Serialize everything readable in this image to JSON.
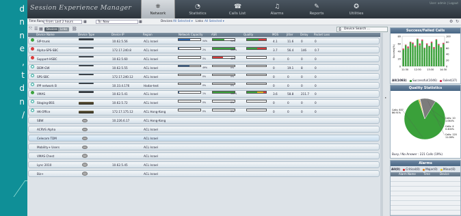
{
  "side_text": [
    "d",
    "n",
    "n",
    "e",
    ",",
    "t",
    "d",
    "n",
    "/"
  ],
  "app": {
    "logo": "Session Experience Manager",
    "user": "User: admin  |  Logout"
  },
  "nav": [
    {
      "label": "Network",
      "icon": "network-icon",
      "glyph": "⛯",
      "active": true
    },
    {
      "label": "Statistics",
      "icon": "statistics-icon",
      "glyph": "◔",
      "active": false
    },
    {
      "label": "Calls List",
      "icon": "calls-list-icon",
      "glyph": "☎",
      "active": false
    },
    {
      "label": "Alarms",
      "icon": "alarms-icon",
      "glyph": "♫",
      "active": false
    },
    {
      "label": "Reports",
      "icon": "reports-icon",
      "glyph": "✎",
      "active": false
    },
    {
      "label": "Utilities",
      "icon": "utilities-icon",
      "glyph": "✪",
      "active": false
    }
  ],
  "toolbar": {
    "time_range_label": "Time Range:",
    "time_range_value": "From: Last 2 hours",
    "to_value": "To: Now",
    "devices_label": "Devices",
    "devices_value": "All Selected ▾",
    "links_label": "Links",
    "links_value": "All Selected ▾",
    "view_devices": "Devices",
    "view_links": "Links",
    "device_search": "Device Search ..."
  },
  "columns": [
    "Device Name",
    "Device Type",
    "Device IP",
    "Region",
    "Network Capacity",
    "ASR",
    "Quality",
    "MOS",
    "Jitter",
    "Delay",
    "Packet Loss"
  ],
  "devices": [
    {
      "name": "SIP-trunk",
      "status": "green",
      "type": "rack",
      "ip": "10.62.5.56",
      "region": "ACL Israel",
      "cap": 54,
      "capc": "#2a69b5",
      "asr": 54,
      "asrc": "#3da33d",
      "quality": [
        [
          "#3da33d",
          0.6
        ],
        [
          "#d93b3b",
          0.4
        ]
      ],
      "mos": "4.1",
      "jitter": "11.6",
      "delay": "0",
      "loss": "0"
    },
    {
      "name": "Alpha-SPS-SBC",
      "status": "red",
      "type": "rack",
      "ip": "172.17.240.8",
      "region": "ACL Israel",
      "cap": 2,
      "capc": "#2a69b5",
      "asr": 100,
      "asrc": "#3da33d",
      "quality": [
        [
          "#3da33d",
          0.55
        ],
        [
          "#d93b3b",
          0.45
        ]
      ],
      "mos": "3.7",
      "jitter": "56.4",
      "delay": "146",
      "loss": "0.7"
    },
    {
      "name": "Support-HSBC",
      "status": "red",
      "type": "rack",
      "ip": "10.62.5.60",
      "region": "ACL Israel",
      "cap": 0,
      "capc": "#2a69b5",
      "asr": 46,
      "asrc": "#d93b3b",
      "quality": [],
      "mos": "0",
      "jitter": "0",
      "delay": "0",
      "loss": "0"
    },
    {
      "name": "DEM-GW",
      "status": "teal",
      "type": "rack",
      "ip": "10.62.5.55",
      "region": "ACL Israel",
      "cap": 49,
      "capc": "#2a69b5",
      "asr": 0,
      "asrc": "#3da33d",
      "quality": [],
      "mos": "0",
      "jitter": "19.1",
      "delay": "8",
      "loss": "0"
    },
    {
      "name": "SPS-SBC",
      "status": "teal",
      "type": "rack",
      "ip": "172.17.240.12",
      "region": "ACL Israel",
      "cap": 0,
      "capc": "#2a69b5",
      "asr": 0,
      "asrc": "#3da33d",
      "quality": [],
      "mos": "0",
      "jitter": "0",
      "delay": "0",
      "loss": "0"
    },
    {
      "name": "IPP network B",
      "status": "teal",
      "type": "rack",
      "ip": "10.33.4.176",
      "region": "Hadar-test",
      "cap": 0,
      "capc": "#2a69b5",
      "asr": 0,
      "asrc": "#3da33d",
      "quality": [],
      "mos": "0",
      "jitter": "0",
      "delay": "0",
      "loss": "0"
    },
    {
      "name": "VMAS",
      "status": "green",
      "type": "rack",
      "ip": "10.62.5.41",
      "region": "ACL Israel",
      "cap": 1,
      "capc": "#2a69b5",
      "asr": 100,
      "asrc": "#3da33d",
      "quality": [
        [
          "#3da33d",
          0.55
        ],
        [
          "#e8b820",
          0.3
        ],
        [
          "#d93b3b",
          0.15
        ]
      ],
      "mos": "3.6",
      "jitter": "58.8",
      "delay": "211.7",
      "loss": "0"
    },
    {
      "name": "Staging-BSS",
      "status": "teal",
      "type": "server",
      "ip": "10.62.5.72",
      "region": "ACL Israel",
      "cap": 0,
      "capc": "#2a69b5",
      "asr": 0,
      "asrc": "#3da33d",
      "quality": [],
      "mos": "0",
      "jitter": "0",
      "delay": "0",
      "loss": "0"
    },
    {
      "name": "HK-Office",
      "status": "teal",
      "type": "server",
      "ip": "172.17.175.12",
      "region": "ACL Hong-Kong",
      "cap": 0,
      "capc": "#2a69b5",
      "asr": 0,
      "asrc": "#3da33d",
      "quality": [],
      "mos": "0",
      "jitter": "0",
      "delay": "0",
      "loss": "0"
    },
    {
      "name": "SBW",
      "status": "none",
      "type": "packet",
      "ip": "10.226.6.17",
      "region": "ACL Hong-Kong",
      "cap": null
    },
    {
      "name": "ACRVS Alpha",
      "status": "none",
      "type": "packet",
      "ip": "",
      "region": "ACL Israel",
      "cap": null
    },
    {
      "name": "Celecom TDM",
      "status": "none",
      "type": "packet",
      "ip": "",
      "region": "ACL Israel",
      "cap": null,
      "sel": true
    },
    {
      "name": "Mobility+ Users",
      "status": "none",
      "type": "packet",
      "ip": "",
      "region": "ACL Israel",
      "cap": null
    },
    {
      "name": "VMAS Chest",
      "status": "none",
      "type": "packet",
      "ip": "",
      "region": "ACL Israel",
      "cap": null
    },
    {
      "name": "Lync 2010",
      "status": "none",
      "type": "packet",
      "ip": "10.62.5.45",
      "region": "ACL Israel",
      "cap": null
    },
    {
      "name": "Biz+",
      "status": "none",
      "type": "packet",
      "ip": "",
      "region": "ACL Israel",
      "cap": null
    }
  ],
  "calls_panel": {
    "title": "Success/Failed Calls",
    "ylabel": "Success(%)",
    "all_label": "All(1083)",
    "success_label": "Successful(1046)",
    "failed_label": "Failed(37)"
  },
  "chart_data": [
    {
      "type": "bar",
      "title": "Success/Failed Calls",
      "ylabel": "Success(%)",
      "categories": [
        "11:30",
        "12:30",
        "13:30",
        "14:30"
      ],
      "x_ticks": [
        "11:30",
        "12:30",
        "13:30",
        "14:30"
      ],
      "y_ticks_left": [
        "0",
        "20",
        "40",
        "60",
        "80"
      ],
      "y_ticks_right": [
        "0",
        "20",
        "40",
        "60",
        "80",
        "100"
      ],
      "series": [
        {
          "name": "Successful(1046)",
          "color": "#3aa03a",
          "values": [
            55,
            70,
            60,
            80,
            75,
            65,
            90,
            70,
            85,
            60,
            72,
            66,
            78,
            58,
            88,
            70,
            62,
            74
          ]
        },
        {
          "name": "Failed(37)",
          "color": "#d43a5a",
          "values": [
            2,
            1,
            3,
            1,
            2,
            2,
            1,
            3,
            2,
            1,
            2,
            1,
            2,
            3,
            1,
            2,
            1,
            2
          ]
        }
      ],
      "ylim": [
        0,
        100
      ]
    },
    {
      "type": "pie",
      "title": "Quality Statistics",
      "categories": [
        "Calls: 837",
        "Calls: 10",
        "Calls: 4",
        "Calls: 120"
      ],
      "values": [
        837,
        10,
        4,
        120
      ],
      "labels": [
        "Calls: 837\n86.91%",
        "Calls: 10\n1.044%",
        "Calls: 4\n0.404%",
        "Calls: 120\n11.08%"
      ],
      "colors": [
        "#3aa03a",
        "#e3b62a",
        "#cfcfcf",
        "#7c7c7c"
      ]
    }
  ],
  "quality_panel": {
    "title": "Quality Statistics",
    "busy": "Busy / No Answer : 221 Calls (19%)"
  },
  "alarms_panel": {
    "title": "Alarms",
    "all": "All(0)",
    "critical": "Critical(0)",
    "major": "Major(0)",
    "minor": "Minor(0)",
    "columns": [
      "",
      "Alarm Name",
      "Time",
      "Device"
    ]
  },
  "colors": {
    "green": "#3da33d",
    "red": "#d93b3b",
    "teal": "#2aa59a",
    "blue": "#2a69b5"
  }
}
